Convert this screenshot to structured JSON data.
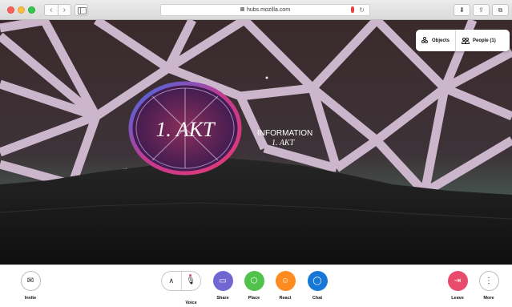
{
  "browser": {
    "url": "hubs.mozilla.com",
    "back_glyph": "‹",
    "forward_glyph": "›"
  },
  "scene": {
    "sign_text": "1. AKT",
    "info_line1": "INFORMATION",
    "info_line2": "1. AKT"
  },
  "top_panel": {
    "objects_label": "Objects",
    "people_label": "People (1)"
  },
  "toolbar": {
    "invite_label": "Invite",
    "voice_label": "Voice",
    "share_label": "Share",
    "place_label": "Place",
    "react_label": "React",
    "chat_label": "Chat",
    "leave_label": "Leave",
    "more_label": "More"
  },
  "colors": {
    "share": "#7167d3",
    "place": "#51c34d",
    "react": "#ff8a1f",
    "chat": "#1777d6",
    "leave": "#e94b6c",
    "lattice": "#cbb6cc"
  }
}
